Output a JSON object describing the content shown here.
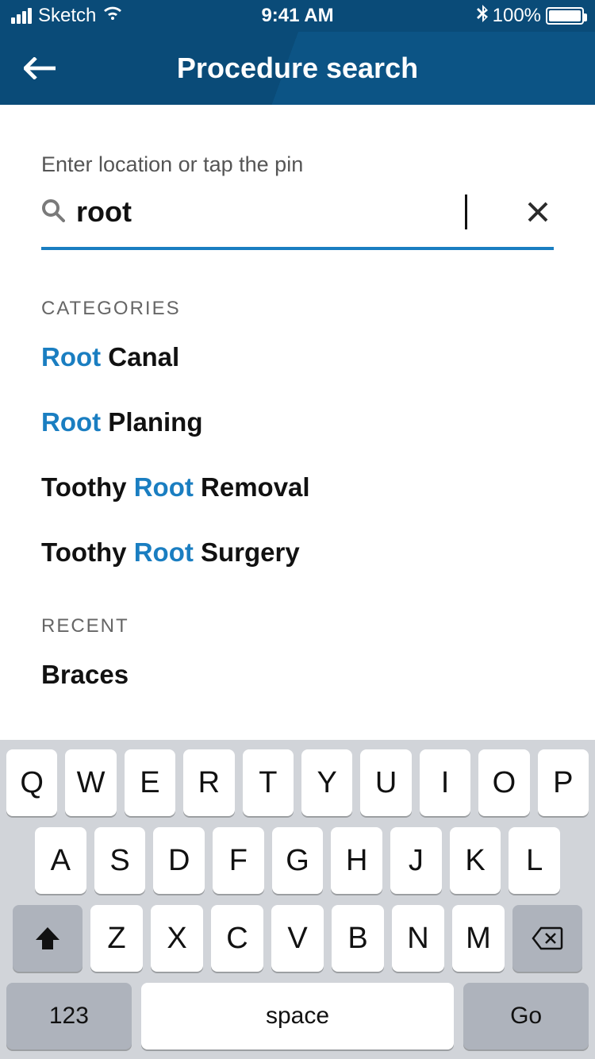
{
  "status": {
    "carrier": "Sketch",
    "time": "9:41 AM",
    "battery_pct": "100%"
  },
  "header": {
    "title": "Procedure search"
  },
  "search": {
    "label": "Enter location or tap the pin",
    "value": "root"
  },
  "sections": {
    "categories_header": "CATEGORIES",
    "recent_header": "RECENT"
  },
  "categories": [
    {
      "pre": "",
      "hl": "Root",
      "post": " Canal"
    },
    {
      "pre": "",
      "hl": "Root",
      "post": " Planing"
    },
    {
      "pre": "Toothy ",
      "hl": "Root",
      "post": " Removal"
    },
    {
      "pre": "Toothy ",
      "hl": "Root",
      "post": " Surgery"
    }
  ],
  "recent": [
    {
      "pre": "Braces",
      "hl": "",
      "post": ""
    }
  ],
  "keyboard": {
    "row1": [
      "Q",
      "W",
      "E",
      "R",
      "T",
      "Y",
      "U",
      "I",
      "O",
      "P"
    ],
    "row2": [
      "A",
      "S",
      "D",
      "F",
      "G",
      "H",
      "J",
      "K",
      "L"
    ],
    "row3": [
      "Z",
      "X",
      "C",
      "V",
      "B",
      "N",
      "M"
    ],
    "numkey": "123",
    "space": "space",
    "go": "Go"
  }
}
